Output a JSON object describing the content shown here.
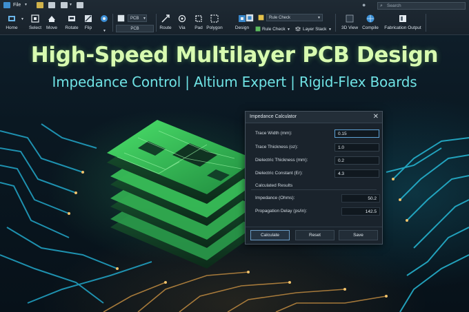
{
  "toolbar": {
    "file_label": "File",
    "search_placeholder": "Search",
    "layer_select": "PCB",
    "layer_field": "PCB",
    "rule_select": "Rule Check",
    "tools": [
      {
        "label": "Home"
      },
      {
        "label": "Select"
      },
      {
        "label": "Move"
      },
      {
        "label": "Rotate"
      },
      {
        "label": "Flip"
      },
      {
        "label": "Route"
      },
      {
        "label": "Via"
      },
      {
        "label": "Pad"
      },
      {
        "label": "Polygon"
      },
      {
        "label": "Design"
      },
      {
        "label": "Rule Check"
      },
      {
        "label": "Layer Stack"
      },
      {
        "label": "3D View"
      },
      {
        "label": "Compile"
      },
      {
        "label": "Fabrication Output"
      }
    ]
  },
  "headline": "High-Speed Multilayer PCB Design",
  "subhead": "Impedance Control | Altium Expert | Rigid-Flex Boards",
  "dialog": {
    "title": "Impedance Calculator",
    "close_glyph": "✕",
    "fields": [
      {
        "label": "Trace Width (mm):",
        "value": "0.15"
      },
      {
        "label": "Trace Thickness (oz):",
        "value": "1.0"
      },
      {
        "label": "Dielectric Thickness (mm):",
        "value": "0.2"
      },
      {
        "label": "Dielectric Constant (Er):",
        "value": "4.3"
      }
    ],
    "results_heading": "Calculated Results",
    "results": [
      {
        "label": "Impedance (Ohms):",
        "value": "50.2"
      },
      {
        "label": "Propagation Delay (ps/in):",
        "value": "142.5"
      }
    ],
    "buttons": {
      "calculate": "Calculate",
      "reset": "Reset",
      "save": "Save"
    }
  },
  "colors": {
    "headline": "#d8fbb0",
    "subhead": "#6fe2e4",
    "board_green": "#3ecf5a",
    "trace_cyan": "#27b9d6"
  }
}
